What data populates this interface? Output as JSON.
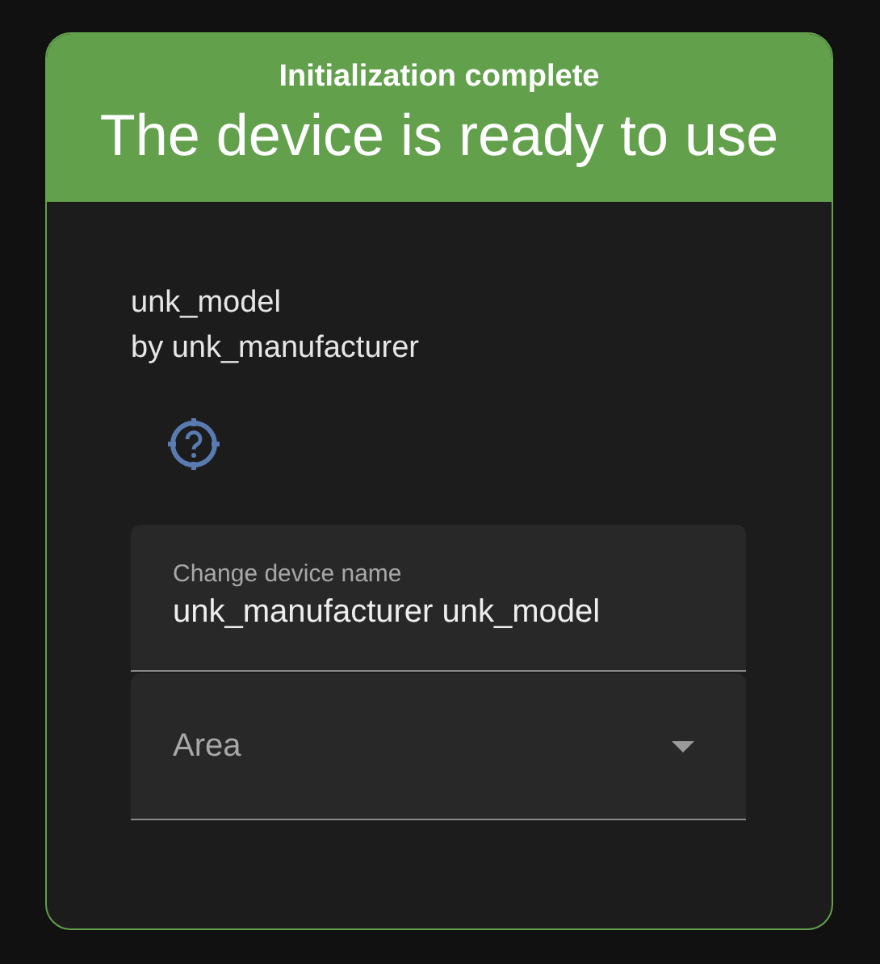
{
  "header": {
    "subtitle": "Initialization complete",
    "title": "The device is ready to use"
  },
  "device": {
    "model": "unk_model",
    "manufacturer": "by unk_manufacturer"
  },
  "name_field": {
    "label": "Change device name",
    "value": "unk_manufacturer unk_model"
  },
  "area_select": {
    "label": "Area"
  }
}
